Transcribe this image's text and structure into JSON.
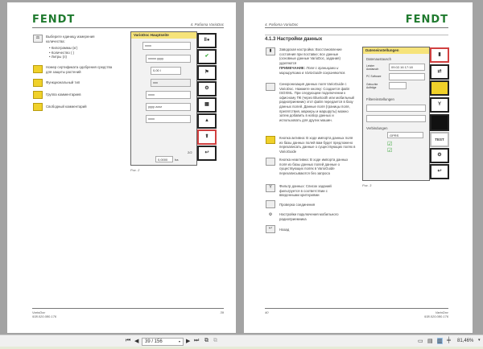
{
  "viewer": {
    "page_indicator": "39 / 156",
    "zoom": "81,46%"
  },
  "left_page": {
    "logo": "FENDT",
    "header": "4. Работа VarioDoc",
    "items": [
      {
        "icon": "unit-icon",
        "text": "Выберите единицу измерения количества:"
      },
      {
        "icon": "certificate-icon",
        "text": "Номер сертификата одобрения средства для защиты растений"
      },
      {
        "icon": "function-icon",
        "text": "Функциональный тип"
      },
      {
        "icon": "comment-group-icon",
        "text": "Группа комментариев"
      },
      {
        "icon": "free-comment-icon",
        "text": "Свободный комментарий"
      }
    ],
    "bullets": [
      "Килограммы (кг)",
      "Количество ( )",
      "Литры (л)"
    ],
    "figure": {
      "title": "VarioDoc Hauptseite",
      "fields": [
        "xxxx",
        "xxxxx yyyy",
        "0,00 l",
        "xxx",
        "xxxx",
        "yyyy zzzz",
        "xxxx"
      ],
      "page": "2/2",
      "value": "0,0000",
      "unit": "ha",
      "caption": "Рис. 2"
    },
    "footer": {
      "product": "VarioDoc",
      "code": "938.020.080.176",
      "page": "39"
    }
  },
  "right_page": {
    "logo": "FENDT",
    "header": "4. Работа VarioDoc",
    "section": "4.1.3 Настройки данных",
    "items": [
      {
        "icon": "trash-icon",
        "text": "Заводская настройка: Восстановление состояния при поставке; все данные (основные данные VarioDoc, задания) удаляются"
      },
      {
        "icon": "sync-icon",
        "text": "Синхронизация данных поля VarioGuide с VarioDoc. Нажмите кнопку: Создается файл ISOXML. При следующем подключении к офисному ПК (через Bluetooth или мобильный радиоприемник) этот файл передается в базу данных полей. Данные поля (границы поля, препятствия, маркеры и маршруты) можно затем добавить в набор данных и использовать для других машин."
      },
      {
        "icon": "import-active-icon",
        "text": "Кнопка активна: В ходе импорта данных поля из базы данных полей вам будет предложено перезаписать данные о существующих полях в VarioGuide"
      },
      {
        "icon": "import-inactive-icon",
        "text": "Кнопка неактивна: В ходе импорта данных поля из базы данных полей данные о существующих полях в VarioGuide перезаписываются без запроса"
      },
      {
        "icon": "filter-icon",
        "text": "Фильтр данных: Список заданий фильтруется в соответствии с введенными критериями"
      },
      {
        "icon": "test-icon",
        "text": "Проверка соединения"
      },
      {
        "icon": "modem-settings-icon",
        "text": "Настройки подключения мобильного радиоприемника"
      },
      {
        "icon": "back-icon",
        "text": "Назад"
      }
    ],
    "note_label": "ПРИМЕЧАНИЕ:",
    "note_text": "Поля с границами и маршрутами в VarioGuide сохраняются.",
    "figure": {
      "title": "Dateneinstellungen",
      "group1": "Datenaustausch",
      "last_export_label": "Letzter Austausch",
      "last_export": "09.02.16 17:18",
      "pc_label": "PC Software",
      "jobs_label": "Gebuchte Aufträge",
      "group2": "Filtereinstellungen",
      "group3": "Verbindungen",
      "connection": "GPRS",
      "test_label": "TEST",
      "caption": "Рис. 3"
    },
    "footer": {
      "product": "VarioDoc",
      "code": "938.020.080.176",
      "page": "40"
    }
  }
}
